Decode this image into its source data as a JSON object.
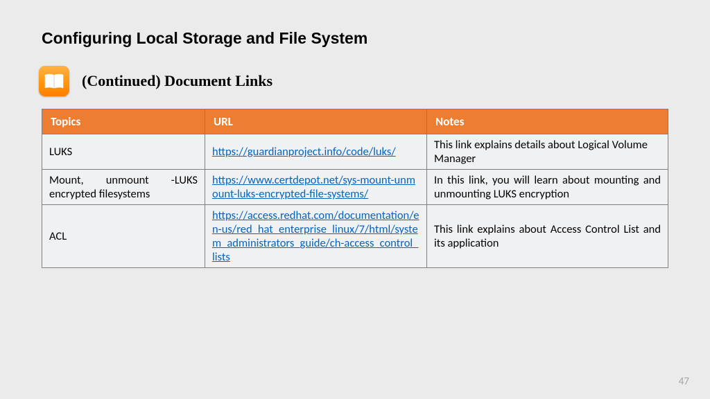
{
  "title": "Configuring Local Storage and File System",
  "subtitle": "(Continued) Document Links",
  "icon_name": "book-icon",
  "headers": {
    "c1": "Topics",
    "c2": "URL",
    "c3": "Notes"
  },
  "rows": [
    {
      "topic": "LUKS",
      "url": "https://guardianproject.info/code/luks/",
      "notes": "This link explains details about Logical Volume Manager",
      "topic_justify": false,
      "notes_justify": false
    },
    {
      "topic": "Mount, unmount -LUKS encrypted filesystems",
      "url": "https://www.certdepot.net/sys-mount-unmount-luks-encrypted-file-systems/",
      "notes": "In this link, you will learn about mounting and unmounting  LUKS encryption",
      "topic_justify": true,
      "notes_justify": true
    },
    {
      "topic": "ACL",
      "url": "https://access.redhat.com/documentation/en-us/red_hat_enterprise_linux/7/html/system_administrators_guide/ch-access_control_lists",
      "notes": "This link explains about Access Control List and its application",
      "topic_justify": false,
      "notes_justify": true
    }
  ],
  "page_number": "47"
}
